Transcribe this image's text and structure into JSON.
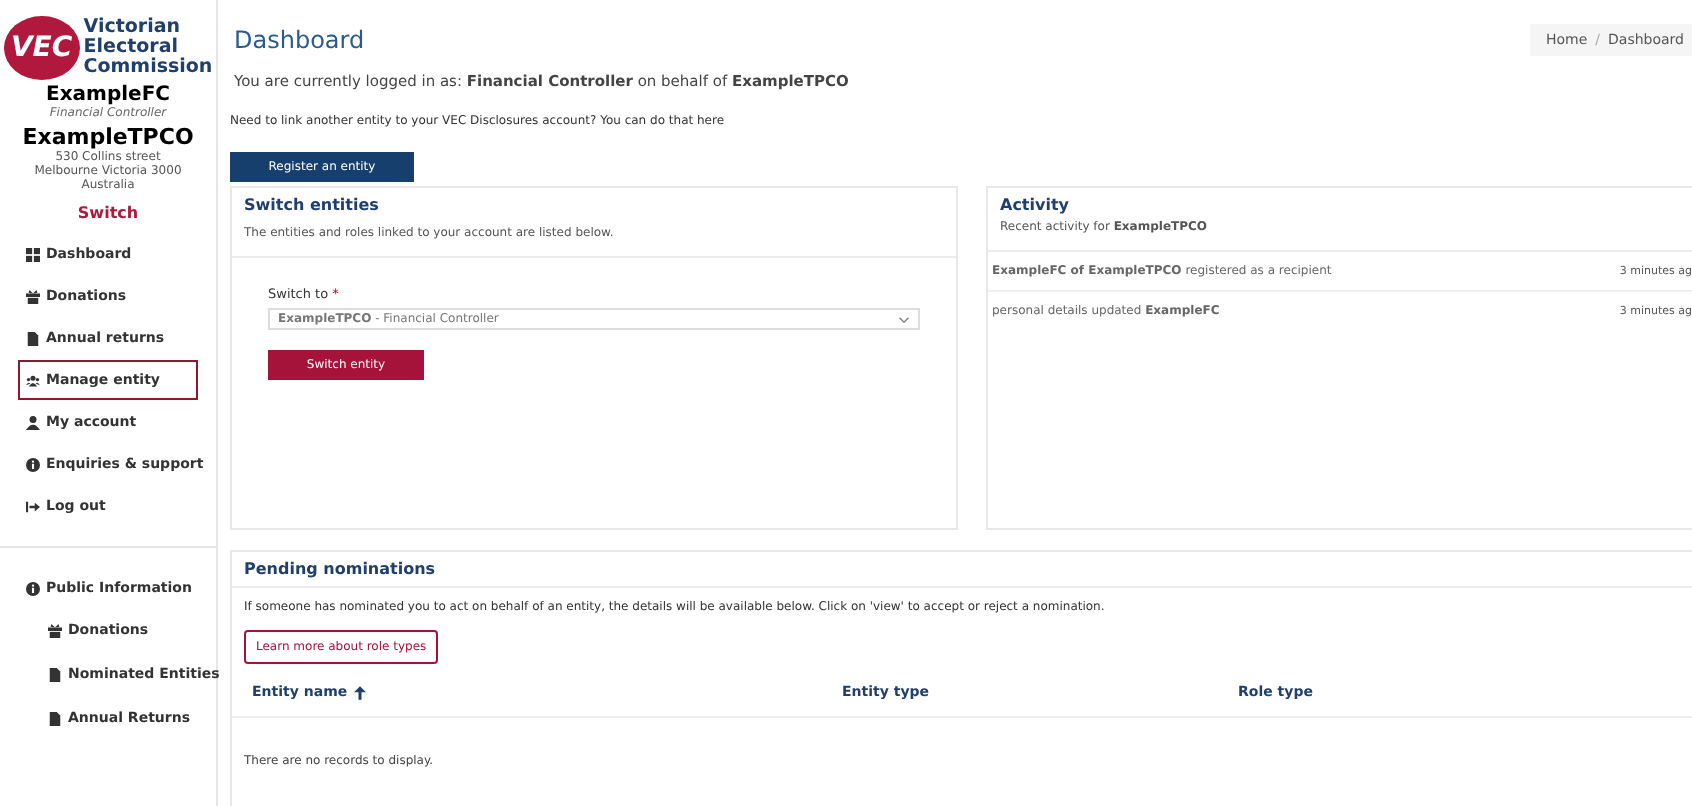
{
  "sidebar": {
    "logo_text": [
      "Victorian",
      "Electoral",
      "Commission"
    ],
    "logo_mark": "VEC",
    "user_name": "ExampleFC",
    "user_role": "Financial Controller",
    "entity_name": "ExampleTPCO",
    "address": [
      "530 Collins street",
      "Melbourne Victoria 3000",
      "Australia"
    ],
    "switch_link": "Switch",
    "items": [
      {
        "label": "Dashboard",
        "selected": false
      },
      {
        "label": "Donations",
        "selected": false
      },
      {
        "label": "Annual returns",
        "selected": false
      },
      {
        "label": "Manage entity",
        "selected": true
      },
      {
        "label": "My account",
        "selected": false
      },
      {
        "label": "Enquiries & support",
        "selected": false
      },
      {
        "label": "Log out",
        "selected": false
      }
    ],
    "public": {
      "label": "Public Information",
      "children": [
        {
          "label": "Donations"
        },
        {
          "label": "Nominated Entities"
        },
        {
          "label": "Annual Returns"
        }
      ]
    }
  },
  "header": {
    "title": "Dashboard",
    "breadcrumb": [
      "Home",
      "Dashboard"
    ],
    "separator": "/"
  },
  "logged_in": "You are currently logged in as: **Financial Controller** on behalf of **ExampleTPCO**",
  "link_prompt": "Need to link another entity to your VEC Disclosures account? You can do that here",
  "register_button": "Register an entity",
  "switch_card": {
    "title": "Switch entities",
    "description": "The entities and roles linked to your account are listed below.",
    "field_label": "Switch to",
    "required_mark": "*",
    "value": "**ExampleTPCO** - Financial Controller",
    "button": "Switch entity"
  },
  "activity_card": {
    "title": "Activity",
    "subtitle": "Recent activity for **ExampleTPCO**",
    "rows": [
      {
        "text": "**ExampleFC of ExampleTPCO** registered as a recipient",
        "time": "3 minutes ag"
      },
      {
        "text": "personal details updated **ExampleFC**",
        "time": "3 minutes ag"
      }
    ]
  },
  "nominations": {
    "title": "Pending nominations",
    "description": "If someone has nominated you to act on behalf of an entity, the details will be available below. Click on 'view' to accept or reject a nomination.",
    "learn_button": "Learn more about role types",
    "columns": [
      {
        "label": "Entity name",
        "sorted": true
      },
      {
        "label": "Entity type",
        "sorted": false
      },
      {
        "label": "Role type",
        "sorted": false
      }
    ],
    "empty": "There are no records to display."
  }
}
